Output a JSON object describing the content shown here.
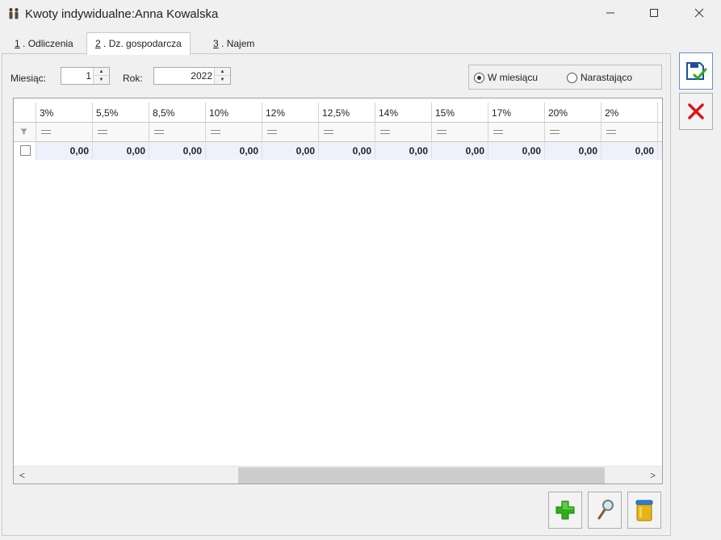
{
  "window": {
    "title": "Kwoty indywidualne:Anna Kowalska",
    "icon": "people-icon",
    "controls": [
      "minimize-icon",
      "maximize-icon",
      "close-icon"
    ]
  },
  "tabs": [
    {
      "key": "1",
      "label": " . Odliczenia",
      "active": false
    },
    {
      "key": "2",
      "label": " . Dz. gospodarcza",
      "active": true
    },
    {
      "key": "3",
      "label": " . Najem",
      "active": false
    }
  ],
  "filters": {
    "month_label": "Miesiąc:",
    "month_value": "1",
    "year_label": "Rok:",
    "year_value": "2022"
  },
  "mode": {
    "options": [
      {
        "label": "W miesiącu",
        "checked": true
      },
      {
        "label": "Narastająco",
        "checked": false
      }
    ]
  },
  "grid": {
    "columns": [
      "3%",
      "5,5%",
      "8,5%",
      "10%",
      "12%",
      "12,5%",
      "14%",
      "15%",
      "17%",
      "20%",
      "2%"
    ],
    "rows": [
      {
        "checked": false,
        "values": [
          "0,00",
          "0,00",
          "0,00",
          "0,00",
          "0,00",
          "0,00",
          "0,00",
          "0,00",
          "0,00",
          "0,00",
          "0,00"
        ]
      }
    ],
    "scroll_left_glyph": "<",
    "scroll_right_glyph": ">"
  },
  "actions": {
    "add_icon": "plus-icon",
    "edit_icon": "magnifier-icon",
    "delete_icon": "trash-icon",
    "save_icon": "save-icon",
    "cancel_icon": "cancel-icon"
  },
  "colors": {
    "row_highlight": "#eef1fb",
    "cancel_red": "#d9151b",
    "add_green": "#2fae19"
  }
}
